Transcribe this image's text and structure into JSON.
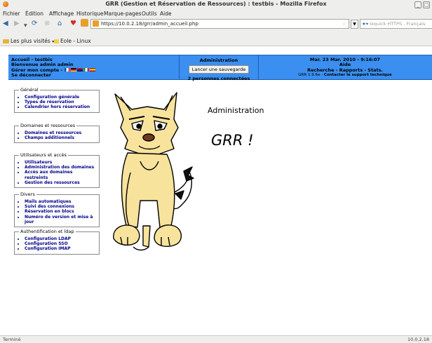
{
  "window": {
    "title": "GRR (Gestion et Réservation de Ressources) : testbis - Mozilla Firefox"
  },
  "menu": [
    "Fichier",
    "Édition",
    "Affichage",
    "Historique",
    "Marque-pages",
    "Outils",
    "Aide"
  ],
  "nav": {
    "url": "https://10.0.2.18/grr/admin_accueil.php",
    "search_placeholder": "Ixquick HTTPS - Français"
  },
  "bookmarks": [
    "Les plus visités",
    "Eole - Linux"
  ],
  "header": {
    "left": [
      "Accueil - testbis",
      "Bienvenue admin admin",
      "Gérer mon compte -",
      "Se déconnecter"
    ],
    "center_title": "Administration",
    "save_button": "Lancer une sauvegarde",
    "connected": "2 personnes connectées",
    "date": "Mar. 23 Mar. 2010 - 9:16:07",
    "help": "Aide",
    "links": "Recherche - Rapports - Stats.",
    "version": "GRR 1.9.6e - ",
    "support": "Contacter le support technique"
  },
  "sections": [
    {
      "title": "Général",
      "items": [
        "Configuration générale",
        "Types de réservation",
        "Calendrier hors réservation"
      ]
    },
    {
      "title": "Domaines et ressources",
      "items": [
        "Domaines et ressources",
        "Champs additionnels"
      ]
    },
    {
      "title": "Utilisateurs et accès",
      "items": [
        "Utilisateurs",
        "Administration des domaines",
        "Accès aux domaines restreints",
        "Gestion des ressources"
      ]
    },
    {
      "title": "Divers",
      "items": [
        "Mails automatiques",
        "Suivi des connexions",
        "Réservation en blocs",
        "Numéro de version et mise à jour"
      ]
    },
    {
      "title": "Authentification et ldap",
      "items": [
        "Configuration LDAP",
        "Configuration SSO",
        "Configuration IMAP"
      ]
    }
  ],
  "main": {
    "title": "Administration",
    "logo_text": "GRR !"
  },
  "status": {
    "left": "Terminé",
    "right": "10.0.2.18"
  }
}
